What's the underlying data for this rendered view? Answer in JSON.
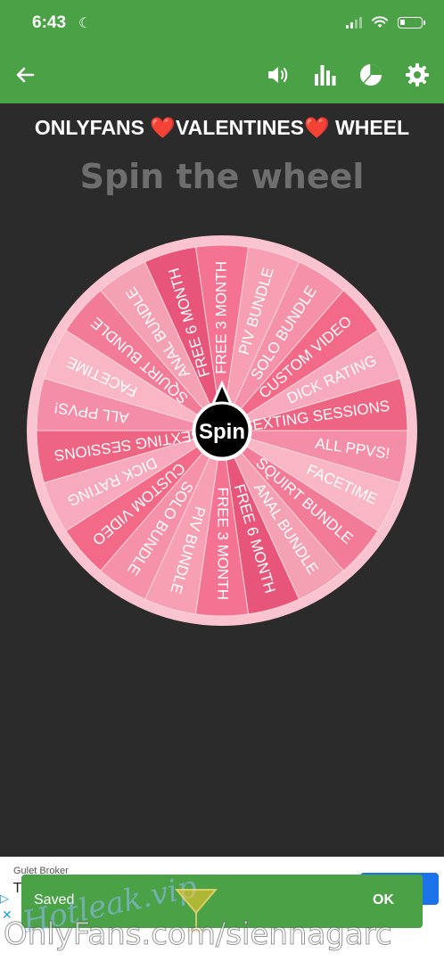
{
  "status_bar": {
    "time": "6:43"
  },
  "app_bar": {
    "icons": [
      "back-arrow-icon",
      "sound-icon",
      "stats-icon",
      "pie-chart-icon",
      "gear-icon"
    ]
  },
  "wheel": {
    "title": "ONLYFANS ❤️VALENTINES❤️ WHEEL",
    "heading": "Spin the wheel",
    "center_label": "Spin",
    "segments": [
      "FREE 3 MONTH",
      "PIV BUNDLE",
      "SOLO BUNDLE",
      "CUSTOM VIDEO",
      "DICK RATING",
      "SEXTING SESSIONS",
      "ALL PPVS!",
      "FACETIME",
      "SQUIRT BUNDLE",
      "ANAL BUNDLE",
      "FREE 6 MONTH",
      "FREE 3 MONTH",
      "PIV BUNDLE",
      "SOLO BUNDLE",
      "CUSTOM VIDEO",
      "DICK RATING",
      "SEXTING SESSIONS",
      "ALL PPVS!",
      "FACETIME",
      "SQUIRT BUNDLE",
      "ANAL BUNDLE",
      "FREE 6 MONTH"
    ],
    "colors": [
      "#f57392",
      "#f7a0b4",
      "#f591a9",
      "#f26a88",
      "#f7aabd",
      "#ee6584",
      "#f48ea8",
      "#f9b7c6",
      "#f27c98",
      "#f5a1b4",
      "#e8557a"
    ]
  },
  "ad": {
    "source": "Gulet Broker",
    "title_initial": "T"
  },
  "toast": {
    "message": "Saved",
    "action": "OK"
  },
  "watermark": {
    "text": "OnlyFans.com/siennagarc",
    "overlay": "Hotleak.vip"
  }
}
